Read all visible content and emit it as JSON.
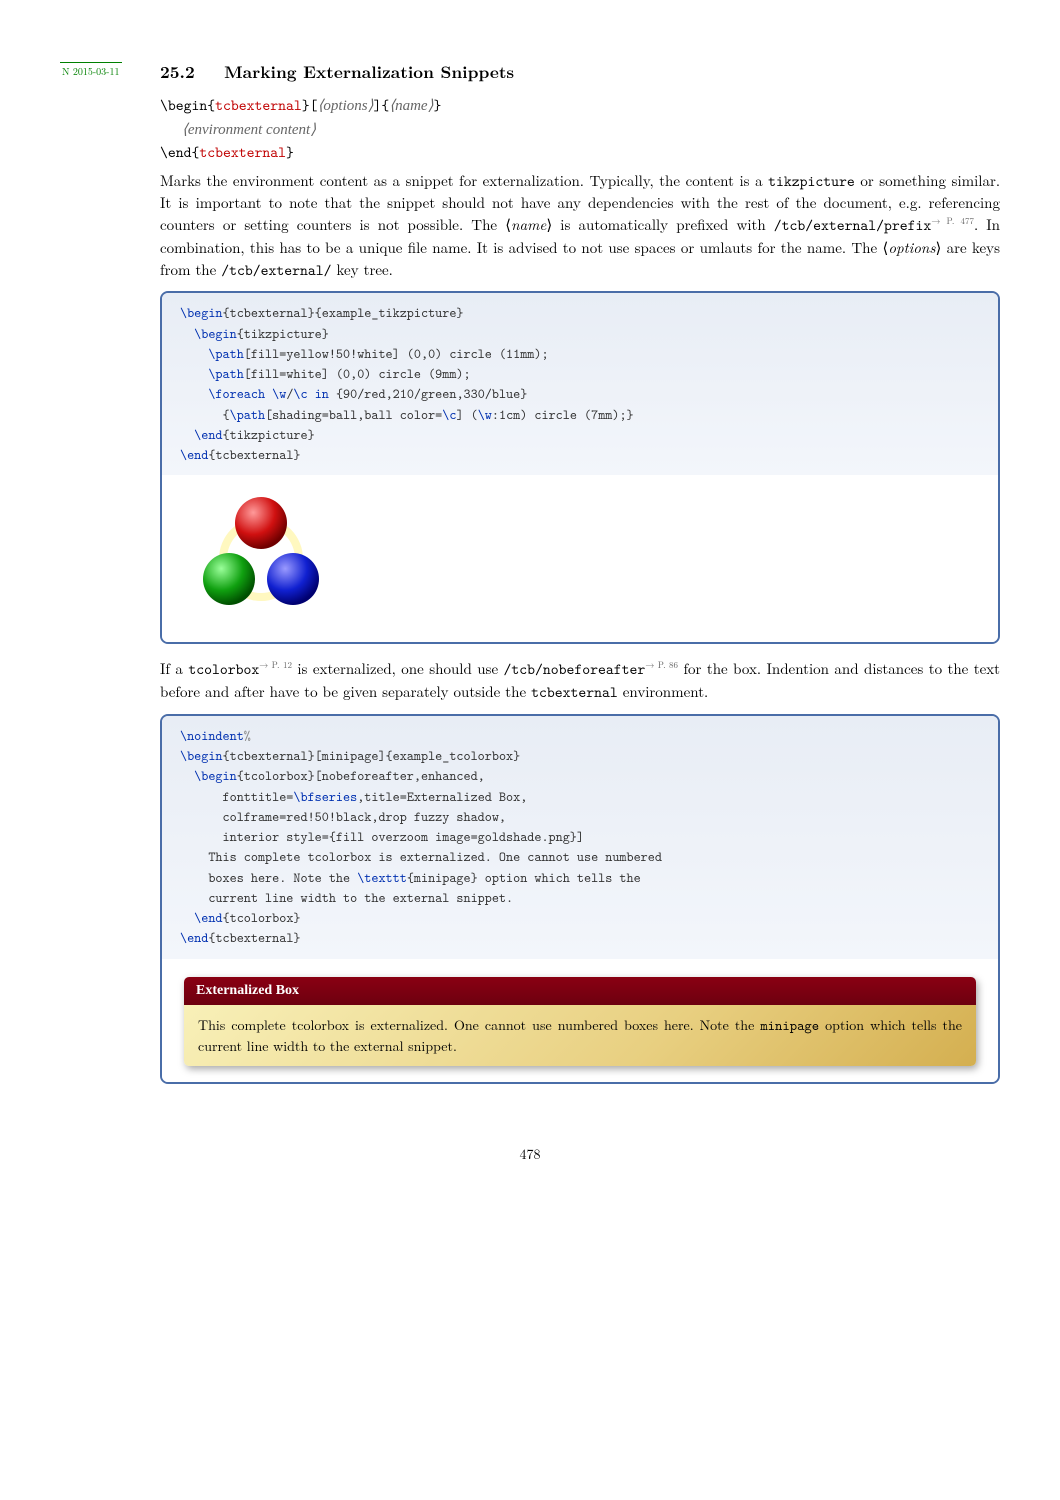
{
  "section": {
    "number": "25.2",
    "title": "Marking Externalization Snippets"
  },
  "version_tag": "N 2015-03-11",
  "signature": {
    "begin": "\\begin",
    "end": "\\end",
    "env": "tcbexternal",
    "options": "options",
    "name": "name",
    "content": "environment content"
  },
  "description": {
    "p1a": "Marks the environment content as a snippet for externalization. Typically, the content is a ",
    "p1b": "tikzpicture",
    "p1c": " or something similar. It is important to note that the snippet should not have any dependencies with the rest of the document, e.g. referencing counters or setting counters is not possible. The ⟨",
    "p1d": "name",
    "p1e": "⟩ is automatically prefixed with ",
    "p1f": "/tcb/external/prefix",
    "p1g": ". In combination, this has to be a unique file name. It is advised to not use spaces or umlauts for the name. The ⟨",
    "p1h": "options",
    "p1i": "⟩ are keys from the ",
    "p1j": "/tcb/external/",
    "p1k": " key tree.",
    "ref1": "→ P. 477"
  },
  "code1": {
    "l1a": "\\begin",
    "l1b": "{tcbexternal}{example_tikzpicture}",
    "l2a": "  \\begin",
    "l2b": "{tikzpicture}",
    "l3a": "    \\path",
    "l3b": "[fill=yellow!50!white] (0,0) circle (11mm);",
    "l4a": "    \\path",
    "l4b": "[fill=white] (0,0) circle (9mm);",
    "l5a": "    \\foreach ",
    "l5b": "\\w",
    "l5c": "/",
    "l5d": "\\c ",
    "l5e": "in ",
    "l5f": "{90/red,210/green,330/blue}",
    "l6a": "      {",
    "l6b": "\\path",
    "l6c": "[shading=ball,ball color=",
    "l6d": "\\c",
    "l6e": "] (",
    "l6f": "\\w",
    "l6g": ":1cm) circle (7mm);}",
    "l7a": "  \\end",
    "l7b": "{tikzpicture}",
    "l8a": "\\end",
    "l8b": "{tcbexternal}"
  },
  "mid": {
    "a": "If a ",
    "b": "tcolorbox",
    "ref_b": "→ P. 12",
    "c": " is externalized, one should use ",
    "d": "/tcb/nobeforeafter",
    "ref_d": "→ P. 86",
    "e": " for the box. Indention and distances to the text before and after have to be given separately outside the ",
    "f": "tcbexternal",
    "g": " environment."
  },
  "code2": {
    "l1a": "\\noindent",
    "l1b": "%",
    "l2a": "\\begin",
    "l2b": "{tcbexternal}[minipage]{example_tcolorbox}",
    "l3a": "  \\begin",
    "l3b": "{tcolorbox}[nobeforeafter,enhanced,",
    "l4": "      fonttitle=",
    "l4b": "\\bfseries",
    "l4c": ",title=Externalized Box,",
    "l5": "      colframe=red!50!black,drop fuzzy shadow,",
    "l6": "      interior style={fill overzoom image=goldshade.png}]",
    "l7": "    This complete tcolorbox is externalized. One cannot use numbered",
    "l8": "    boxes here. Note the ",
    "l8b": "\\texttt",
    "l8c": "{minipage} option which tells the",
    "l9": "    current line width to the external snippet.",
    "l10a": "  \\end",
    "l10b": "{tcolorbox}",
    "l11a": "\\end",
    "l11b": "{tcbexternal}"
  },
  "externbox": {
    "title": "Externalized Box",
    "body_a": "This complete tcolorbox is externalized. One cannot use numbered boxes here. Note the ",
    "body_tt": "minipage",
    "body_b": " option which tells the current line width to the external snippet."
  },
  "page_number": "478"
}
